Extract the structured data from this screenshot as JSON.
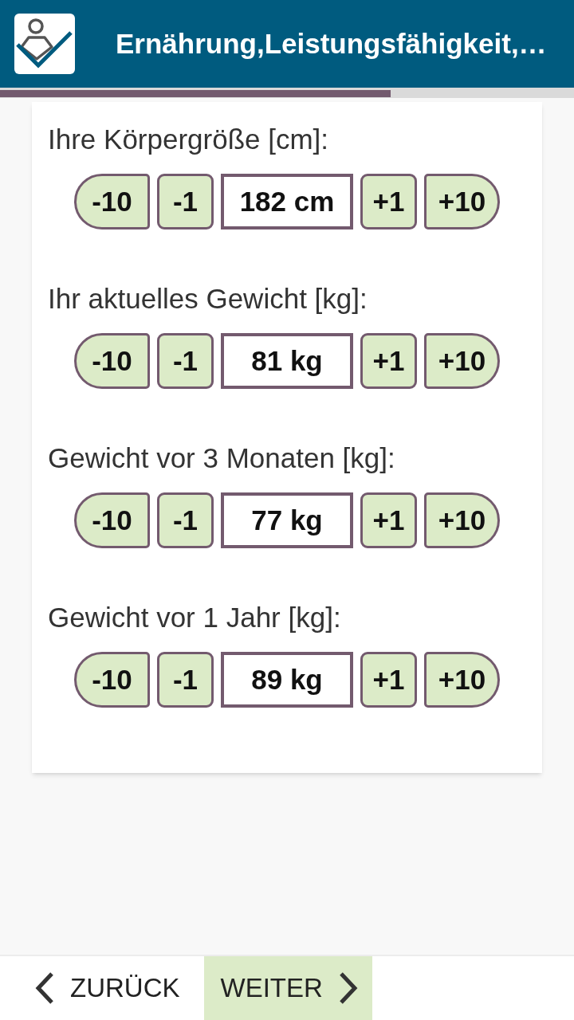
{
  "app_bar": {
    "title": "Ernährung,Leistungsfähigkeit,…"
  },
  "progress": {
    "level": 0.68
  },
  "fields": [
    {
      "label": "Ihre Körpergröße [cm]:",
      "minus_buttons": [
        "-10",
        "-1"
      ],
      "value": "182 cm",
      "plus_buttons": [
        "+1",
        "+10"
      ]
    },
    {
      "label": "Ihr aktuelles Gewicht [kg]:",
      "minus_buttons": [
        "-10",
        "-1"
      ],
      "value": "81 kg",
      "plus_buttons": [
        "+1",
        "+10"
      ]
    },
    {
      "label": "Gewicht vor 3 Monaten [kg]:",
      "minus_buttons": [
        "-10",
        "-1"
      ],
      "value": "77 kg",
      "plus_buttons": [
        "+1",
        "+10"
      ]
    },
    {
      "label": "Gewicht vor 1 Jahr [kg]:",
      "minus_buttons": [
        "-10",
        "-1"
      ],
      "value": "89 kg",
      "plus_buttons": [
        "+1",
        "+10"
      ]
    }
  ],
  "navigation": [
    {
      "label": "ZURÜCK",
      "kind": "back",
      "primary": false
    },
    {
      "label": "WEITER",
      "kind": "next",
      "primary": true
    }
  ]
}
